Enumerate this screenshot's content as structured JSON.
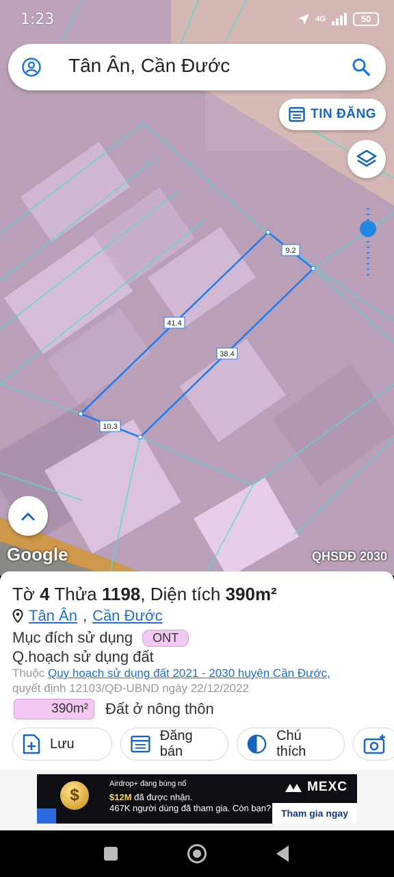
{
  "status": {
    "time": "1:23",
    "network": "4G",
    "battery": "50"
  },
  "search": {
    "text": "Tân Ân, Cần Đước"
  },
  "tin_dang": {
    "label": "TIN ĐĂNG"
  },
  "map": {
    "edges": {
      "top": "9.2",
      "left": "41.4",
      "right": "38.4",
      "bottom": "10.3"
    },
    "attribution": "Google",
    "layer": "QHSDĐ 2030"
  },
  "parcel": {
    "sheet_label": "Tờ",
    "sheet": "4",
    "plot_label": "Thửa",
    "plot": "1198",
    "area_label": ", Diện tích",
    "area": "390m²",
    "ward": "Tân Ân",
    "district": "Cần Đước",
    "purpose_label": "Mục đích sử dụng",
    "purpose_code": "ONT",
    "plan_title": "Q.hoạch sử dụng đất",
    "plan_prefix": "Thuộc",
    "plan_link": "Quy hoạch sử dụng đất 2021 - 2030 huyện Cần Đước,",
    "plan_decision": "quyết định 12103/QĐ-UBND ngày 22/12/2022",
    "area_chip": "390m²",
    "area_desc": "Đất ở nông thôn"
  },
  "actions": {
    "save": "Lưu",
    "sell": "Đăng bán",
    "legend": "Chú thích"
  },
  "ad": {
    "line1": "Airdrop+ đang bùng nổ",
    "line2_amount": "$12M",
    "line2_rest": "đã được nhận.",
    "line3": "467K người dùng đã tham gia. Còn bạn?",
    "brand": "MEXC",
    "cta": "Tham gia ngay"
  },
  "colors": {
    "accent": "#1565c0",
    "parcel_line": "#1e7bf0",
    "zone": "#f3c9f4"
  }
}
